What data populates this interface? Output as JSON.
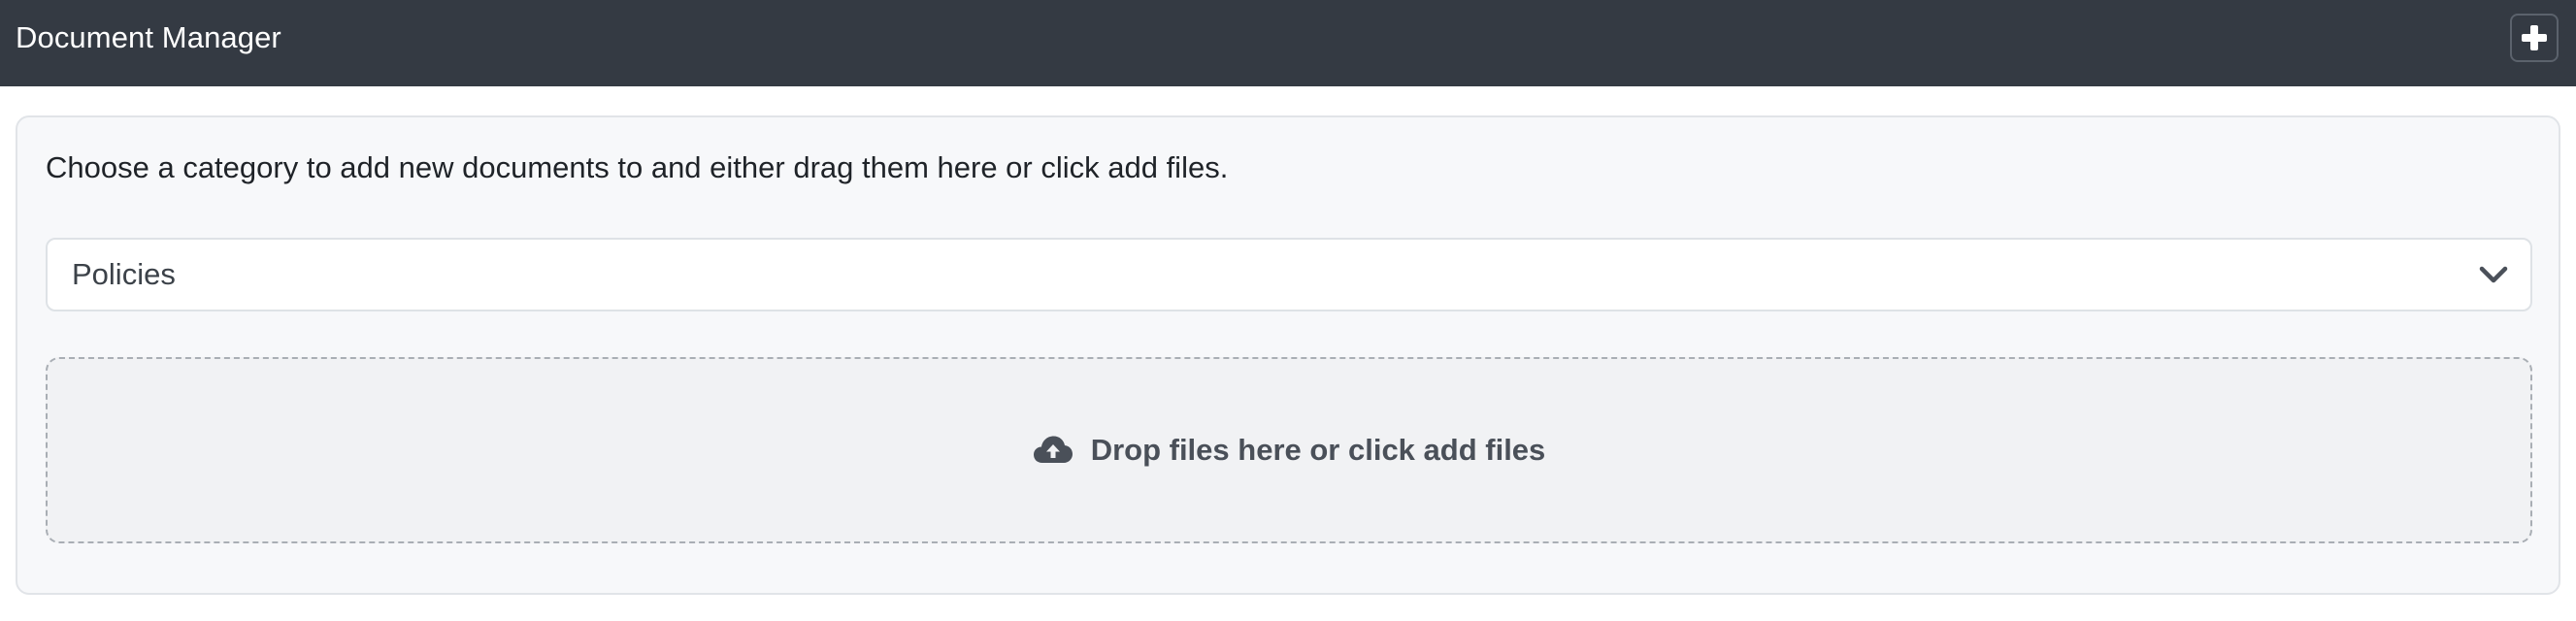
{
  "header": {
    "title": "Document Manager",
    "add_button_icon": "plus-icon"
  },
  "panel": {
    "instructions": "Choose a category to add new documents to and either drag them here or click add files.",
    "category_select": {
      "selected": "Policies",
      "icon": "chevron-down-icon"
    },
    "dropzone": {
      "icon": "cloud-upload-icon",
      "label": "Drop files here or click add files"
    }
  },
  "colors": {
    "header_bg": "#343a43",
    "panel_bg": "#f7f8fa",
    "dropzone_bg": "#f1f2f4",
    "dropzone_text": "#4a5059"
  }
}
